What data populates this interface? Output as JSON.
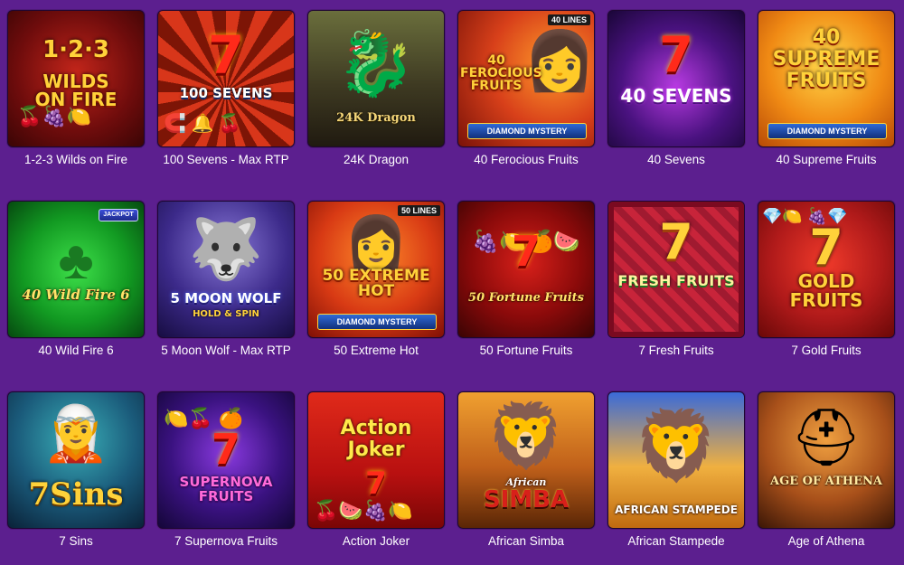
{
  "games": [
    {
      "title": "1-2-3 Wilds on Fire",
      "art_main": "1·2·3",
      "art_sub": "WILDS\nON FIRE"
    },
    {
      "title": "100 Sevens - Max RTP",
      "art_main": "100 SEVENS",
      "art_sub": "7"
    },
    {
      "title": "24K Dragon",
      "art_main": "24K Dragon",
      "art_sub": ""
    },
    {
      "title": "40 Ferocious Fruits",
      "art_main": "40\nFEROCIOUS\nFRUITS",
      "art_sub": "DIAMOND MYSTERY",
      "badge": "40 LINES"
    },
    {
      "title": "40 Sevens",
      "art_main": "40 SEVENS",
      "art_sub": "7"
    },
    {
      "title": "40 Supreme Fruits",
      "art_main": "40\nSUPREME\nFRUITS",
      "art_sub": "DIAMOND MYSTERY"
    },
    {
      "title": "40 Wild Fire 6",
      "art_main": "40 Wild Fire 6",
      "art_sub": "JACKPOT"
    },
    {
      "title": "5 Moon Wolf - Max RTP",
      "art_main": "5 MOON WOLF",
      "art_sub": "HOLD & SPIN"
    },
    {
      "title": "50 Extreme Hot",
      "art_main": "50 EXTREME\nHOT",
      "art_sub": "DIAMOND MYSTERY",
      "badge": "50 LINES"
    },
    {
      "title": "50 Fortune Fruits",
      "art_main": "50 Fortune Fruits",
      "art_sub": "7"
    },
    {
      "title": "7 Fresh Fruits",
      "art_main": "FRESH FRUITS",
      "art_sub": "7"
    },
    {
      "title": "7 Gold Fruits",
      "art_main": "GOLD\nFRUITS",
      "art_sub": "7"
    },
    {
      "title": "7 Sins",
      "art_main": "7Sins",
      "art_sub": ""
    },
    {
      "title": "7 Supernova Fruits",
      "art_main": "SUPERNOVA\nFRUITS",
      "art_sub": "7"
    },
    {
      "title": "Action Joker",
      "art_main": "Action\nJoker",
      "art_sub": "7"
    },
    {
      "title": "African Simba",
      "art_main": "SIMBA",
      "art_sub": "African"
    },
    {
      "title": "African Stampede",
      "art_main": "AFRICAN STAMPEDE",
      "art_sub": ""
    },
    {
      "title": "Age of Athena",
      "art_main": "AGE OF ATHENA",
      "art_sub": ""
    }
  ],
  "colors": {
    "page_background": "#5c1f8f",
    "title_text": "#ffffff"
  }
}
